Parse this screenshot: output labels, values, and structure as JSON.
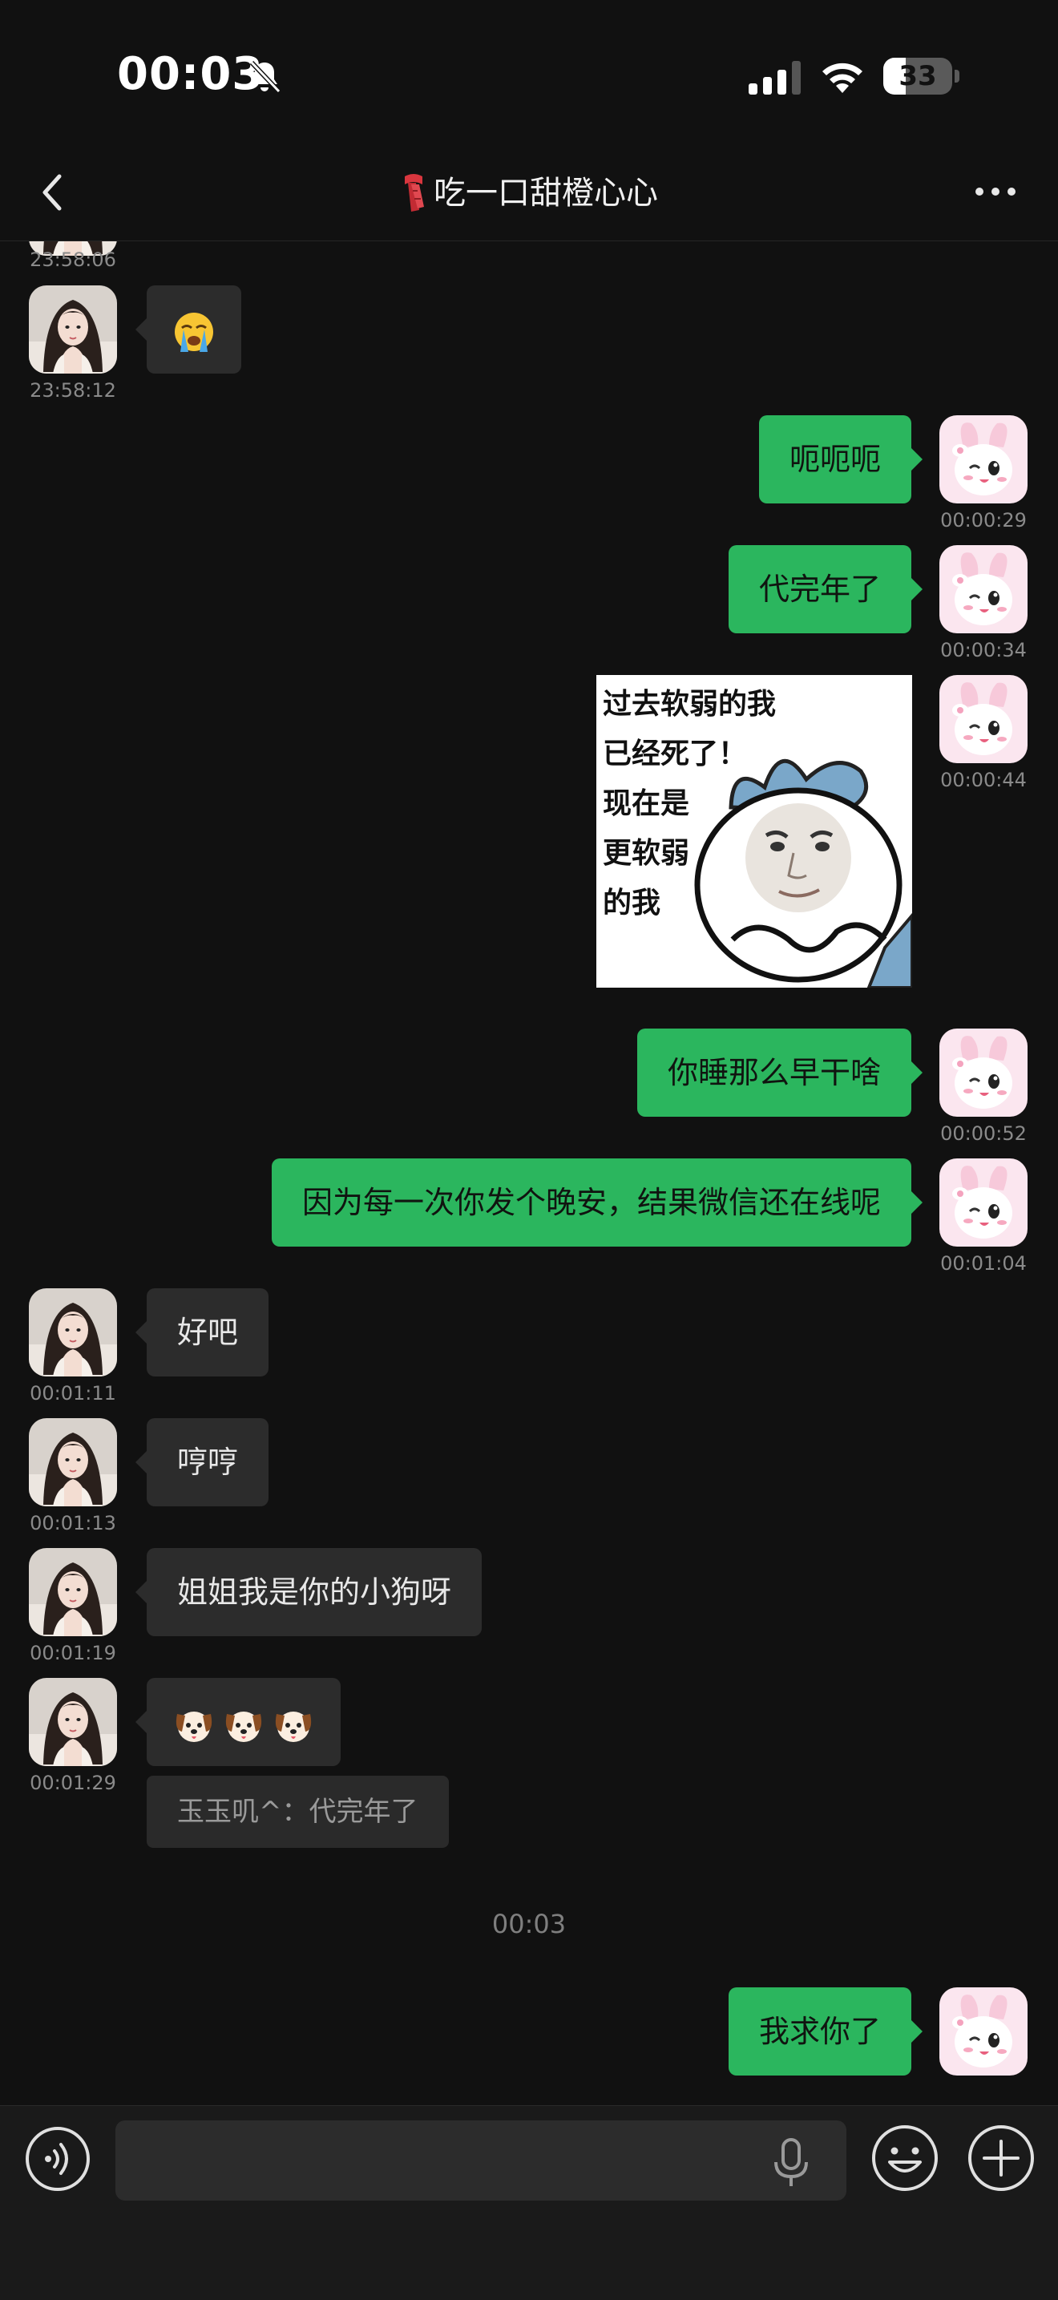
{
  "status_bar": {
    "time": "00:03",
    "battery": "33",
    "battery_level": 0.33
  },
  "header": {
    "title": "吃一口甜橙心心"
  },
  "messages": [
    {
      "side": "in",
      "time": "23:58:06",
      "partial": true
    },
    {
      "side": "in",
      "time": "23:58:12",
      "emoji": [
        "crying-face-emoji"
      ]
    },
    {
      "side": "out",
      "time": "00:00:29",
      "text": "呃呃呃"
    },
    {
      "side": "out",
      "time": "00:00:34",
      "text": "代完年了"
    },
    {
      "side": "out",
      "time": "00:00:44",
      "sticker_text": [
        "过去软弱的我",
        "已经死了！",
        "现在是",
        "更软弱",
        "的我"
      ]
    },
    {
      "side": "out",
      "time": "00:00:52",
      "text": "你睡那么早干啥"
    },
    {
      "side": "out",
      "time": "00:01:04",
      "text": "因为每一次你发个晚安，结果微信还在线呢"
    },
    {
      "side": "in",
      "time": "00:01:11",
      "text": "好吧"
    },
    {
      "side": "in",
      "time": "00:01:13",
      "text": "哼哼"
    },
    {
      "side": "in",
      "time": "00:01:19",
      "text": "姐姐我是你的小狗呀"
    },
    {
      "side": "in",
      "time": "00:01:29",
      "emoji": [
        "dog-face-emoji",
        "dog-face-emoji",
        "dog-face-emoji"
      ],
      "quote": "玉玉叽^：代完年了"
    },
    {
      "separator": "00:03"
    },
    {
      "side": "out",
      "text": "我求你了"
    }
  ],
  "input": {
    "placeholder": ""
  },
  "colors": {
    "background": "#111111",
    "outgoing_bubble": "#2bb65e",
    "incoming_bubble": "#2c2c2c"
  },
  "icons": {
    "back": "chevron-left-icon",
    "more": "more-dots-icon",
    "voice": "voice-mode-icon",
    "mic": "microphone-icon",
    "emoji": "emoji-face-icon",
    "plus": "plus-icon"
  }
}
